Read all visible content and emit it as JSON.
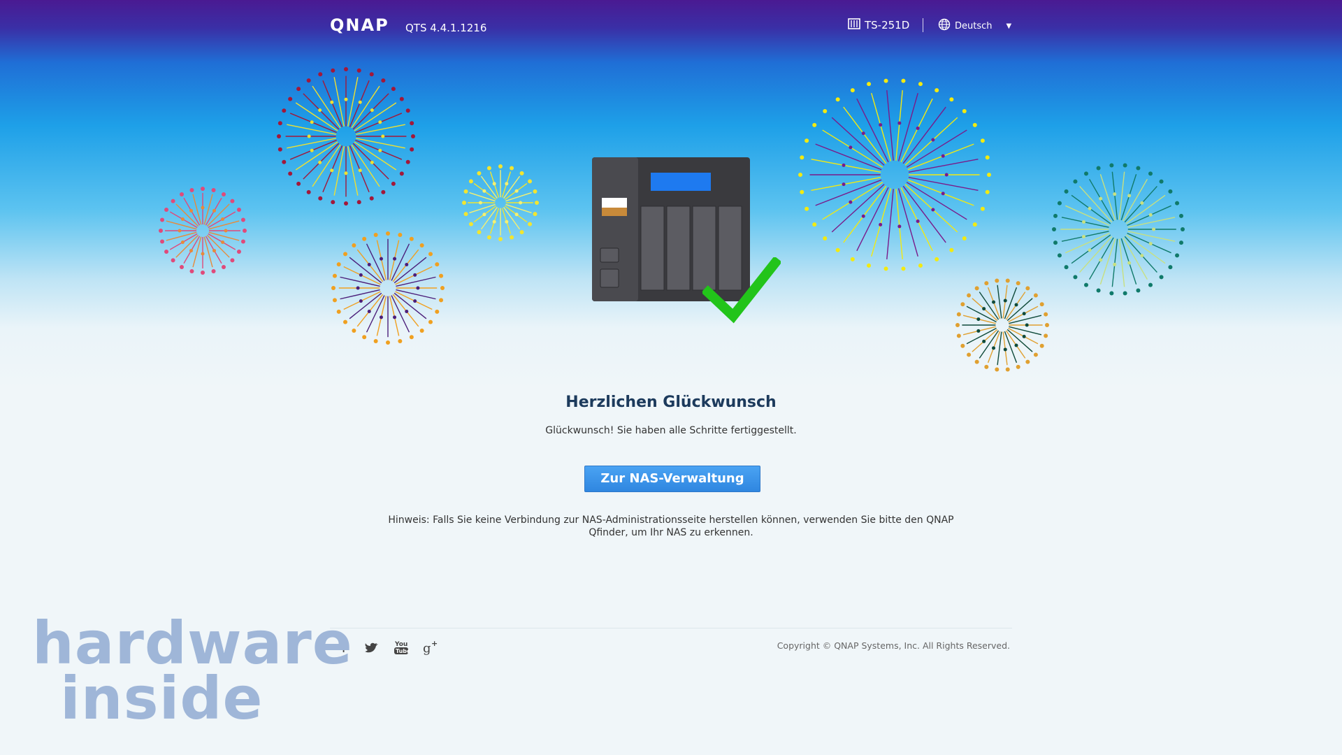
{
  "header": {
    "logo": "QNAP",
    "version": "QTS 4.4.1.1216",
    "model": "TS-251D",
    "language": "Deutsch"
  },
  "main": {
    "title": "Herzlichen Glückwunsch",
    "message": "Glückwunsch! Sie haben alle Schritte fertiggestellt.",
    "button_label": "Zur NAS-Verwaltung",
    "hint": "Hinweis: Falls Sie keine Verbindung zur NAS-Administrationsseite herstellen können, verwenden Sie bitte den QNAP Qfinder, um Ihr NAS zu erkennen."
  },
  "footer": {
    "copyright": "Copyright © QNAP Systems, Inc. All Rights Reserved.",
    "social": [
      "facebook-icon",
      "twitter-icon",
      "youtube-icon",
      "google-plus-icon"
    ]
  },
  "watermark": {
    "line1": "hardware",
    "line2": "inside"
  },
  "colors": {
    "accent": "#2f86e0",
    "title": "#1c3a5c",
    "check": "#22c41a"
  }
}
